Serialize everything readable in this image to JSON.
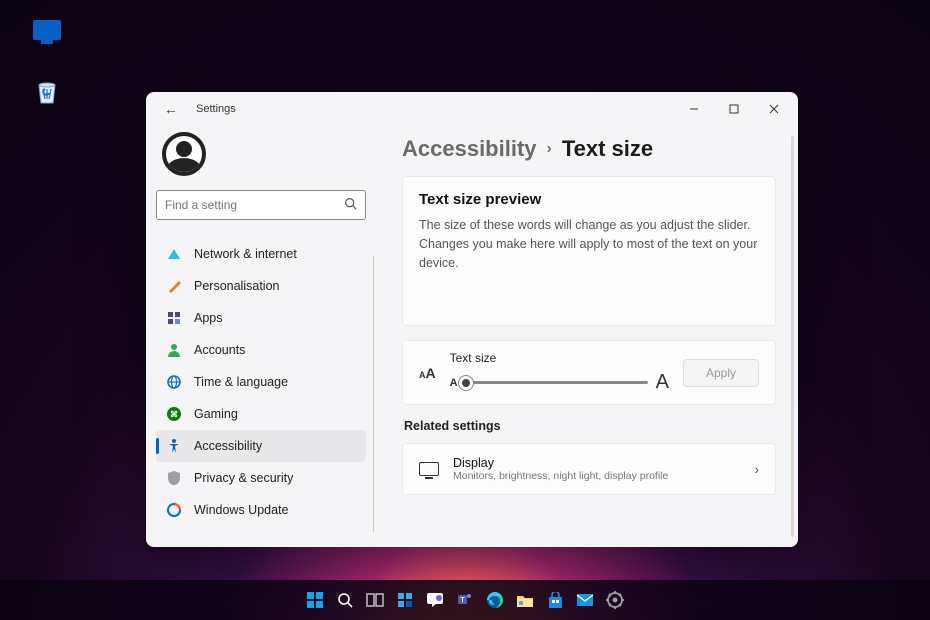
{
  "desktop": {
    "icons": {
      "monitor_label": "",
      "recycle_label": ""
    }
  },
  "window": {
    "title": "Settings",
    "search_placeholder": "Find a setting",
    "nav": [
      {
        "label": "Network & internet",
        "icon": "wifi",
        "color": "#0fb1e0"
      },
      {
        "label": "Personalisation",
        "icon": "brush",
        "color": "#e08a2a"
      },
      {
        "label": "Apps",
        "icon": "grid",
        "color": "#4a4a4a"
      },
      {
        "label": "Accounts",
        "icon": "person",
        "color": "#2eab5b"
      },
      {
        "label": "Time & language",
        "icon": "globe",
        "color": "#1671c5"
      },
      {
        "label": "Gaming",
        "icon": "game",
        "color": "#7fba00"
      },
      {
        "label": "Accessibility",
        "icon": "access",
        "color": "#0067c0",
        "active": true
      },
      {
        "label": "Privacy & security",
        "icon": "shield",
        "color": "#8a8a8a"
      },
      {
        "label": "Windows Update",
        "icon": "update",
        "color": "#f25022"
      }
    ],
    "breadcrumb": {
      "parent": "Accessibility",
      "current": "Text size"
    },
    "preview": {
      "heading": "Text size preview",
      "body": "The size of these words will change as you adjust the slider. Changes you make here will apply to most of the text on your device."
    },
    "slider": {
      "label": "Text size",
      "small_mark": "A",
      "large_mark": "A",
      "icon_small": "A",
      "icon_large": "A",
      "apply_label": "Apply"
    },
    "related_heading": "Related settings",
    "related_item": {
      "title": "Display",
      "subtitle": "Monitors, brightness, night light, display profile"
    }
  },
  "taskbar": {
    "items": [
      "start",
      "search",
      "taskview",
      "widgets",
      "chat",
      "teams",
      "edge",
      "explorer",
      "store",
      "mail",
      "settings"
    ]
  }
}
